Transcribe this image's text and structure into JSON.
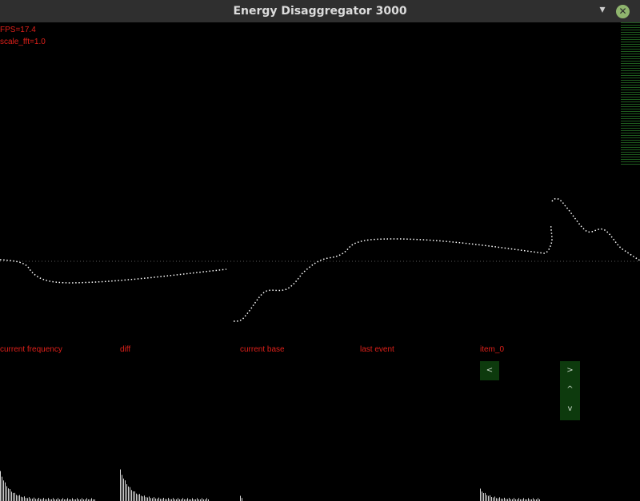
{
  "window": {
    "title": "Energy Disaggregator 3000",
    "minimize_glyph": "▾",
    "close_glyph": "✕"
  },
  "overlay": {
    "fps": "FPS=17.4",
    "scale": "scale_fft=1.0"
  },
  "panels": [
    {
      "label": "current frequency"
    },
    {
      "label": "diff"
    },
    {
      "label": "current base"
    },
    {
      "label": "last event"
    },
    {
      "label": "item_0"
    }
  ],
  "controls": {
    "prev": "<",
    "next": ">",
    "up": "^",
    "down": "v"
  },
  "colors": {
    "overlay_text": "#e0201a",
    "button_bg": "#0d3a0d",
    "waveform": "#ffffff",
    "titlebar": "#2f2f2f"
  }
}
